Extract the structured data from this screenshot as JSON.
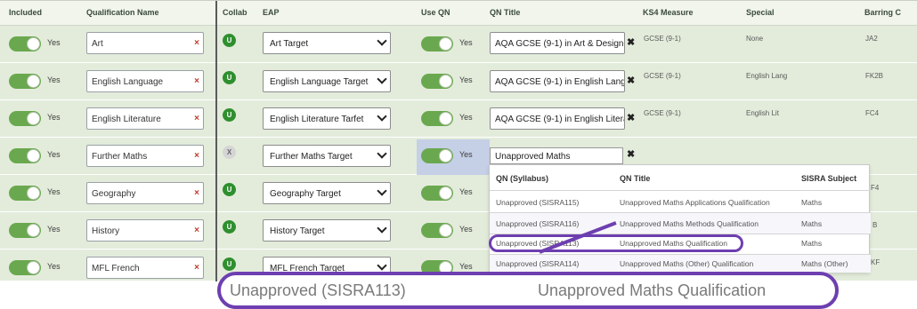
{
  "header": {
    "included": "Included",
    "qualification_name": "Qualification Name",
    "collab": "Collab",
    "eap": "EAP",
    "use_qn": "Use QN",
    "qn_title": "QN Title",
    "ks4_measure": "KS4 Measure",
    "special": "Special",
    "barring": "Barring C"
  },
  "yes": "Yes",
  "collab_u": "U",
  "collab_x": "X",
  "clear": "✖",
  "required": "×",
  "rows": [
    {
      "name": "Art",
      "eap": "Art Target",
      "qn": "AQA GCSE (9-1) in Art & Design",
      "ks4": "GCSE (9-1)",
      "special": "None",
      "barring": "JA2"
    },
    {
      "name": "English Language",
      "eap": "English Language Target",
      "qn": "AQA GCSE (9-1) in English Language",
      "ks4": "GCSE (9-1)",
      "special": "English Lang",
      "barring": "FK2B"
    },
    {
      "name": "English Literature",
      "eap": "English Literature Tarfet",
      "qn": "AQA GCSE (9-1) in English Literature",
      "ks4": "GCSE (9-1)",
      "special": "English Lit",
      "barring": "FC4"
    },
    {
      "name": "Further Maths",
      "eap": "Further Maths Target",
      "qn": "Unapproved Maths",
      "ks4": "",
      "special": "",
      "barring": ""
    },
    {
      "name": "Geography",
      "eap": "Geography Target",
      "barring": "F4"
    },
    {
      "name": "History",
      "eap": "History Target",
      "barring": "B"
    },
    {
      "name": "MFL French",
      "eap": "MFL French Target",
      "barring": "KF"
    }
  ],
  "dropdown": {
    "col1": "QN (Syllabus)",
    "col2": "QN Title",
    "col3": "SISRA Subject",
    "items": [
      {
        "code": "Unapproved (SISRA115)",
        "title": "Unapproved Maths Applications Qualification",
        "subject": "Maths"
      },
      {
        "code": "Unapproved (SISRA116)",
        "title": "Unapproved Maths Methods Qualification",
        "subject": "Maths"
      },
      {
        "code": "Unapproved (SISRA113)",
        "title": "Unapproved Maths Qualification",
        "subject": "Maths"
      },
      {
        "code": "Unapproved (SISRA114)",
        "title": "Unapproved Maths (Other) Qualification",
        "subject": "Maths (Other)"
      }
    ]
  },
  "zoom": {
    "code": "Unapproved (SISRA113)",
    "title": "Unapproved Maths Qualification"
  }
}
